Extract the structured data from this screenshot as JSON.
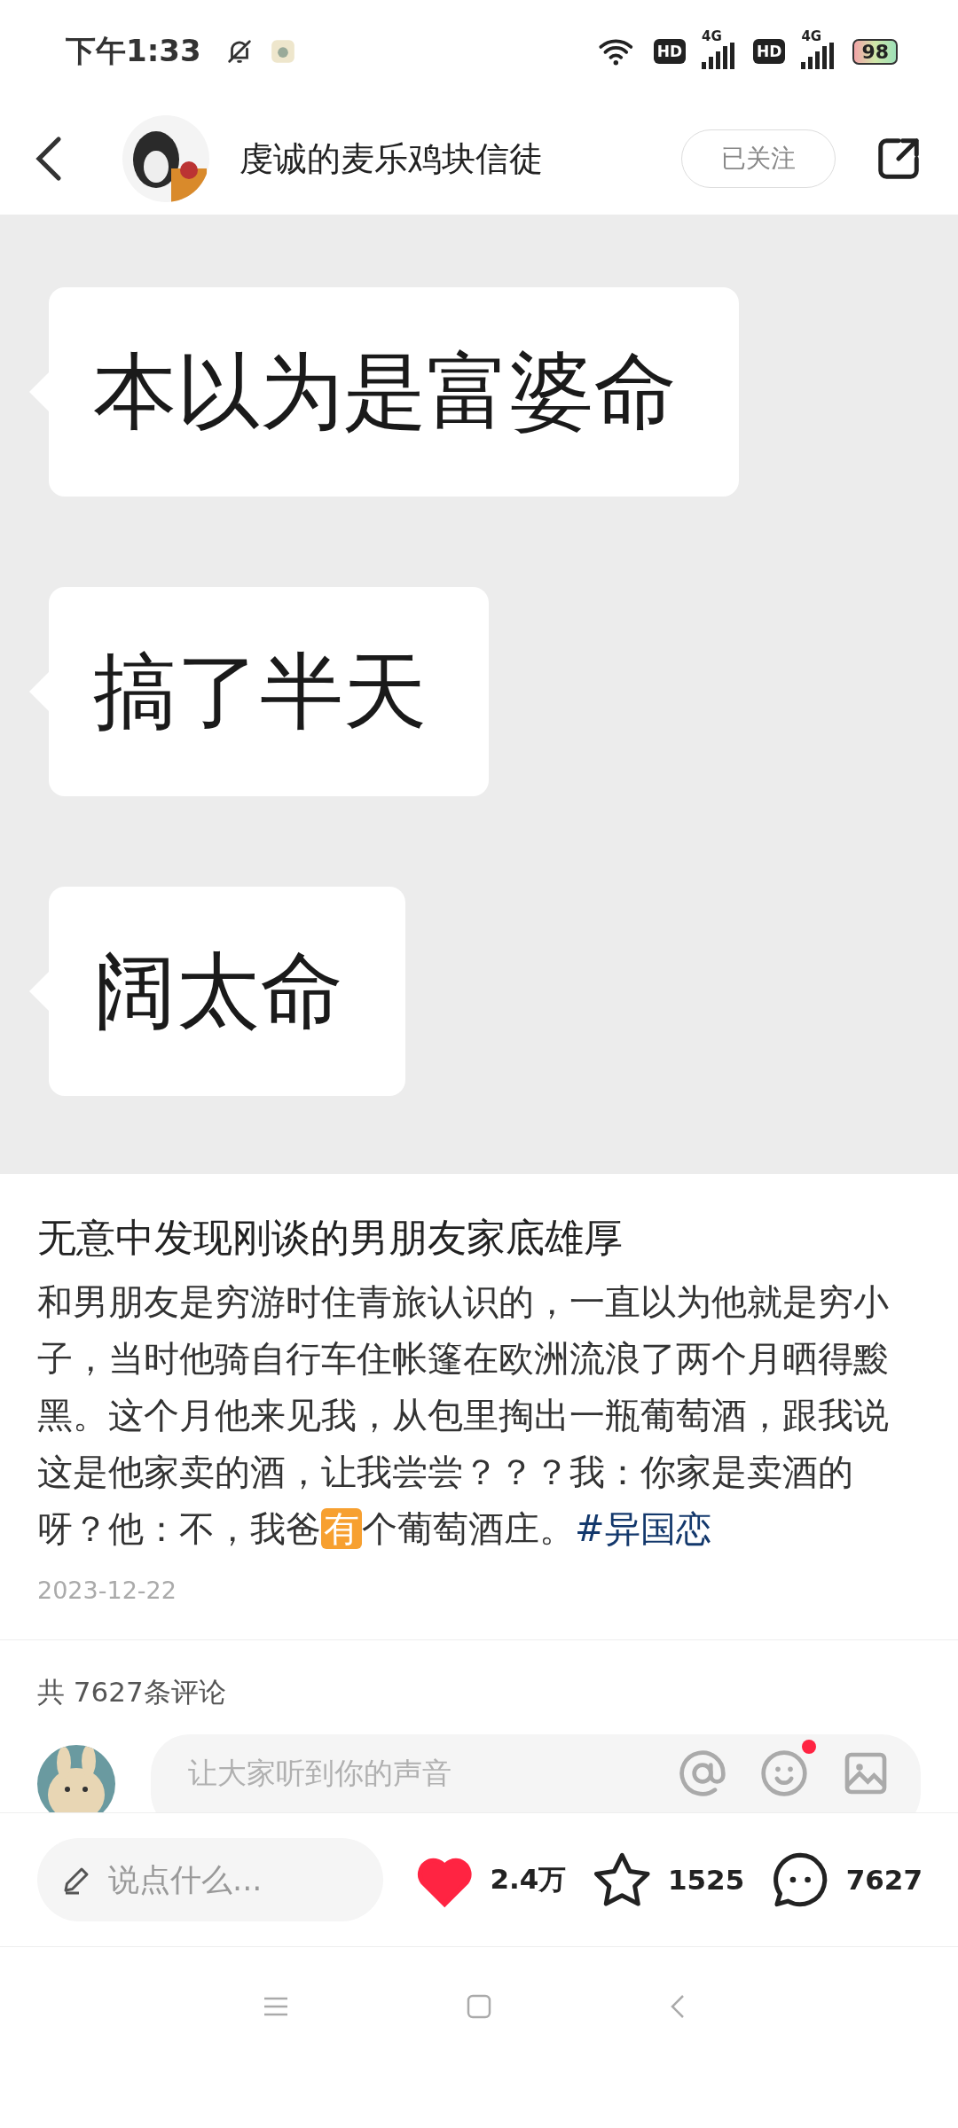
{
  "status_bar": {
    "time": "下午1:33",
    "battery": "98",
    "network_1": "4G",
    "network_2": "4G",
    "hd_1": "HD",
    "hd_2": "HD"
  },
  "header": {
    "author": "虔诚的麦乐鸡块信徒",
    "follow_button": {
      "label": "已关注",
      "followed": true
    }
  },
  "post_image": {
    "bubbles": [
      "本以为是富婆命",
      "搞了半天",
      "阔太命"
    ]
  },
  "post": {
    "title": "无意中发现刚谈的男朋友家底雄厚",
    "body": [
      {
        "kind": "text",
        "text": "和男朋友是穷游时住青旅认识的，一直以为他就是穷小子，当时他骑自行车住帐篷在欧洲流浪了两个月晒得黢黑。这个月他来见我，从包里掏出一瓶葡萄酒，跟我说这是他家卖的酒，让我尝尝？？？我：你家是卖酒的呀？他：不，我爸"
      },
      {
        "kind": "badge",
        "text": "有"
      },
      {
        "kind": "text",
        "text": "个葡萄酒庄。"
      },
      {
        "kind": "hashtag",
        "text": "#异国恋"
      }
    ],
    "date": "2023-12-22"
  },
  "comments": {
    "count_label": "共 7627条评论",
    "input": {
      "placeholder": "让大家听到你的声音"
    },
    "emoji_has_new": true
  },
  "action_bar": {
    "input": {
      "placeholder": "说点什么..."
    },
    "likes": {
      "count": "2.4万",
      "liked": true
    },
    "favorites": {
      "count": "1525",
      "favorited": false
    },
    "comments": {
      "count": "7627"
    }
  }
}
